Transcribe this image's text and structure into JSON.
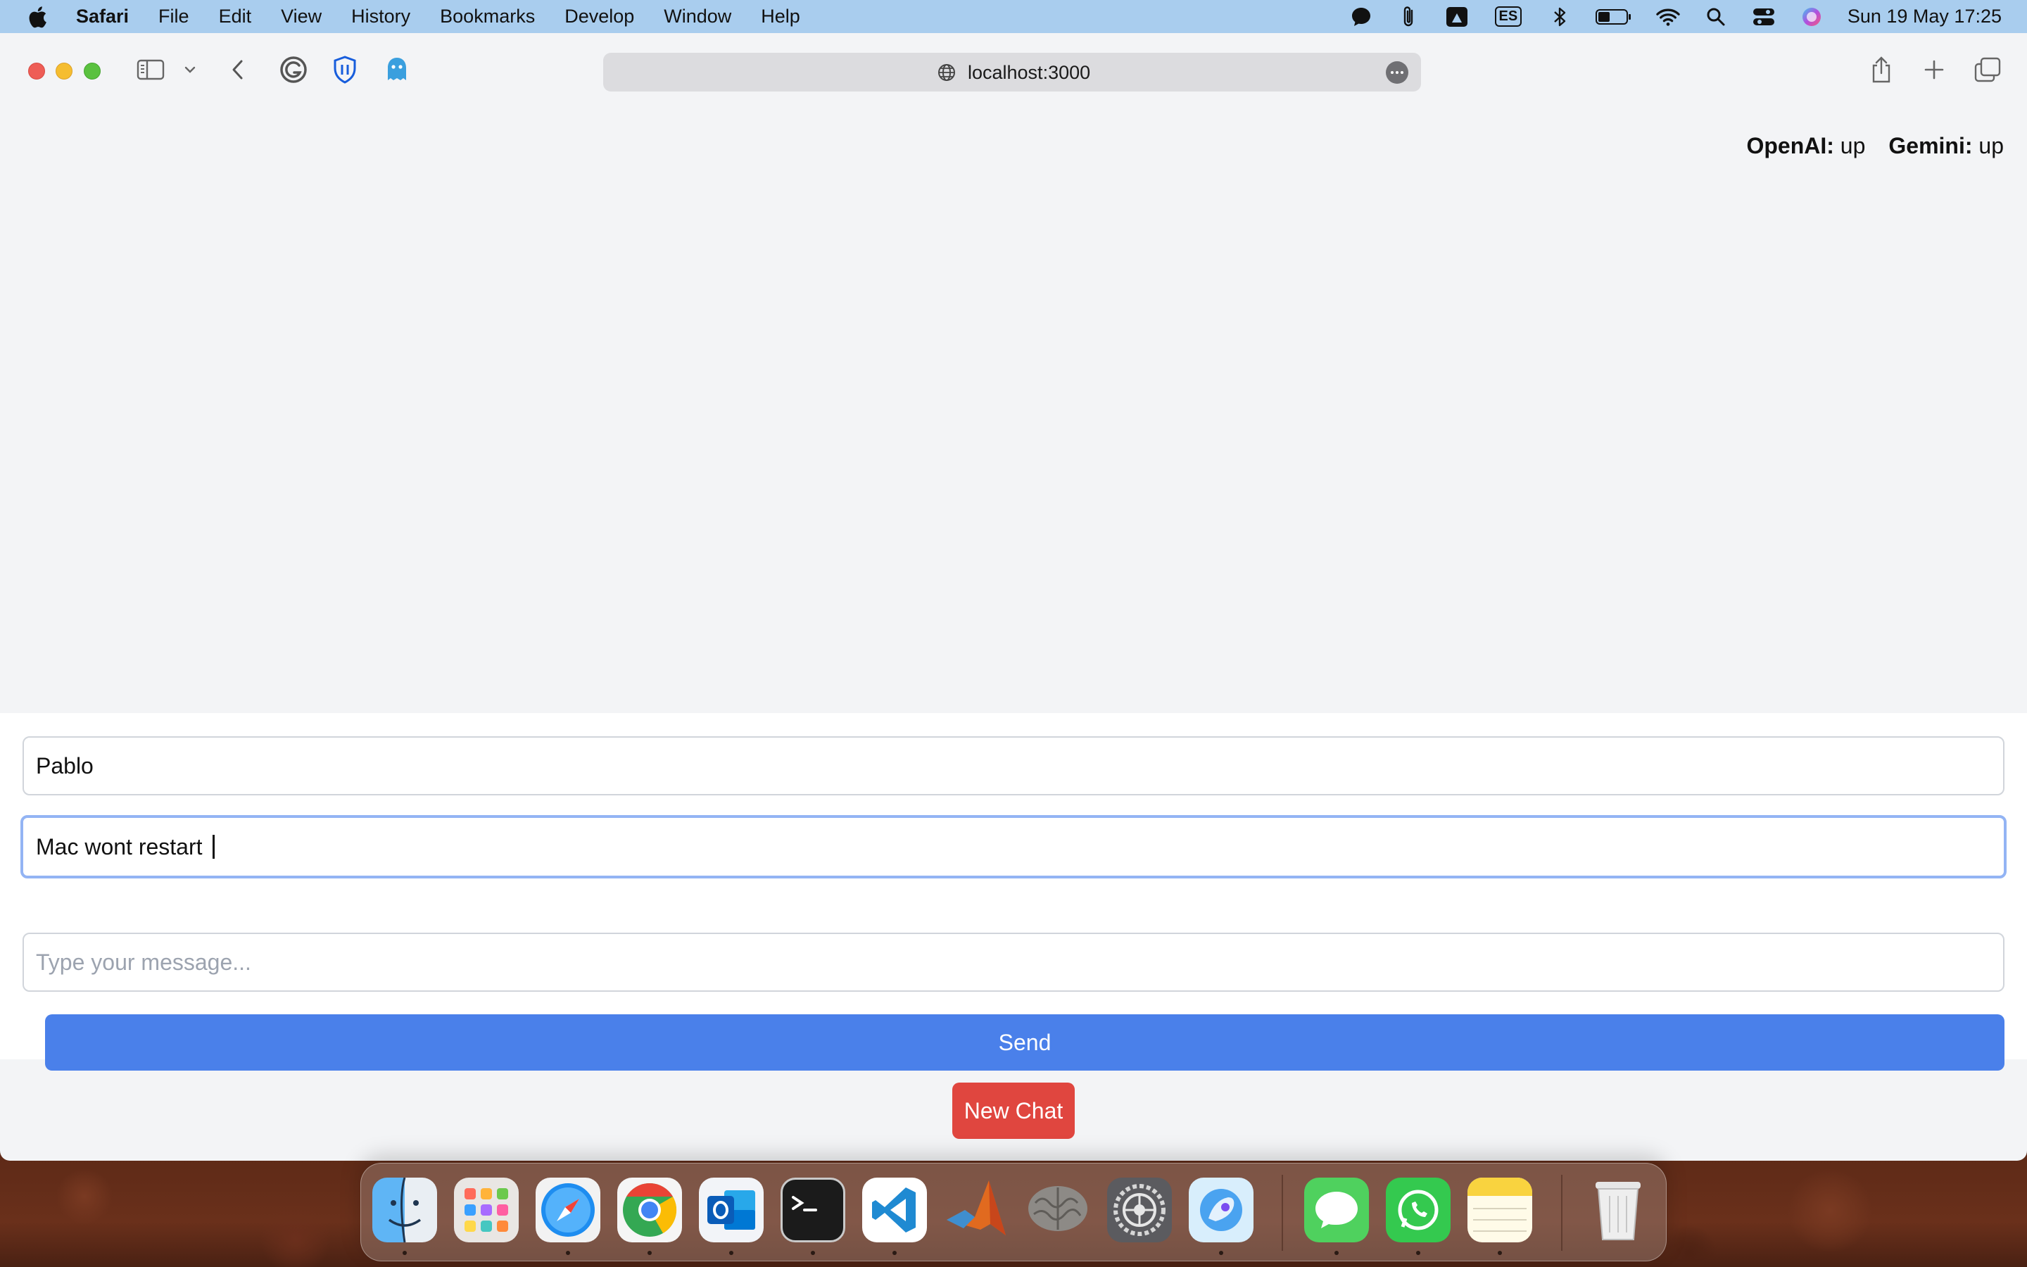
{
  "menubar": {
    "app_name": "Safari",
    "items": [
      "File",
      "Edit",
      "View",
      "History",
      "Bookmarks",
      "Develop",
      "Window",
      "Help"
    ],
    "input_source": "ES",
    "clock": "Sun 19 May  17:25"
  },
  "browser": {
    "url": "localhost:3000"
  },
  "status": {
    "openai_label": "OpenAI:",
    "openai_value": "up",
    "gemini_label": "Gemini:",
    "gemini_value": "up"
  },
  "form": {
    "name_value": "Pablo",
    "subject_value": "Mac wont restart ",
    "message_placeholder": "Type your message...",
    "send_label": "Send"
  },
  "new_chat_label": "New Chat",
  "dock": {
    "apps": [
      "Finder",
      "Launchpad",
      "Safari",
      "Chrome",
      "Outlook",
      "Terminal",
      "VS Code",
      "MATLAB",
      "Brain",
      "System Settings",
      "Copilot",
      "Messages",
      "WhatsApp",
      "Notes",
      "Trash"
    ]
  }
}
